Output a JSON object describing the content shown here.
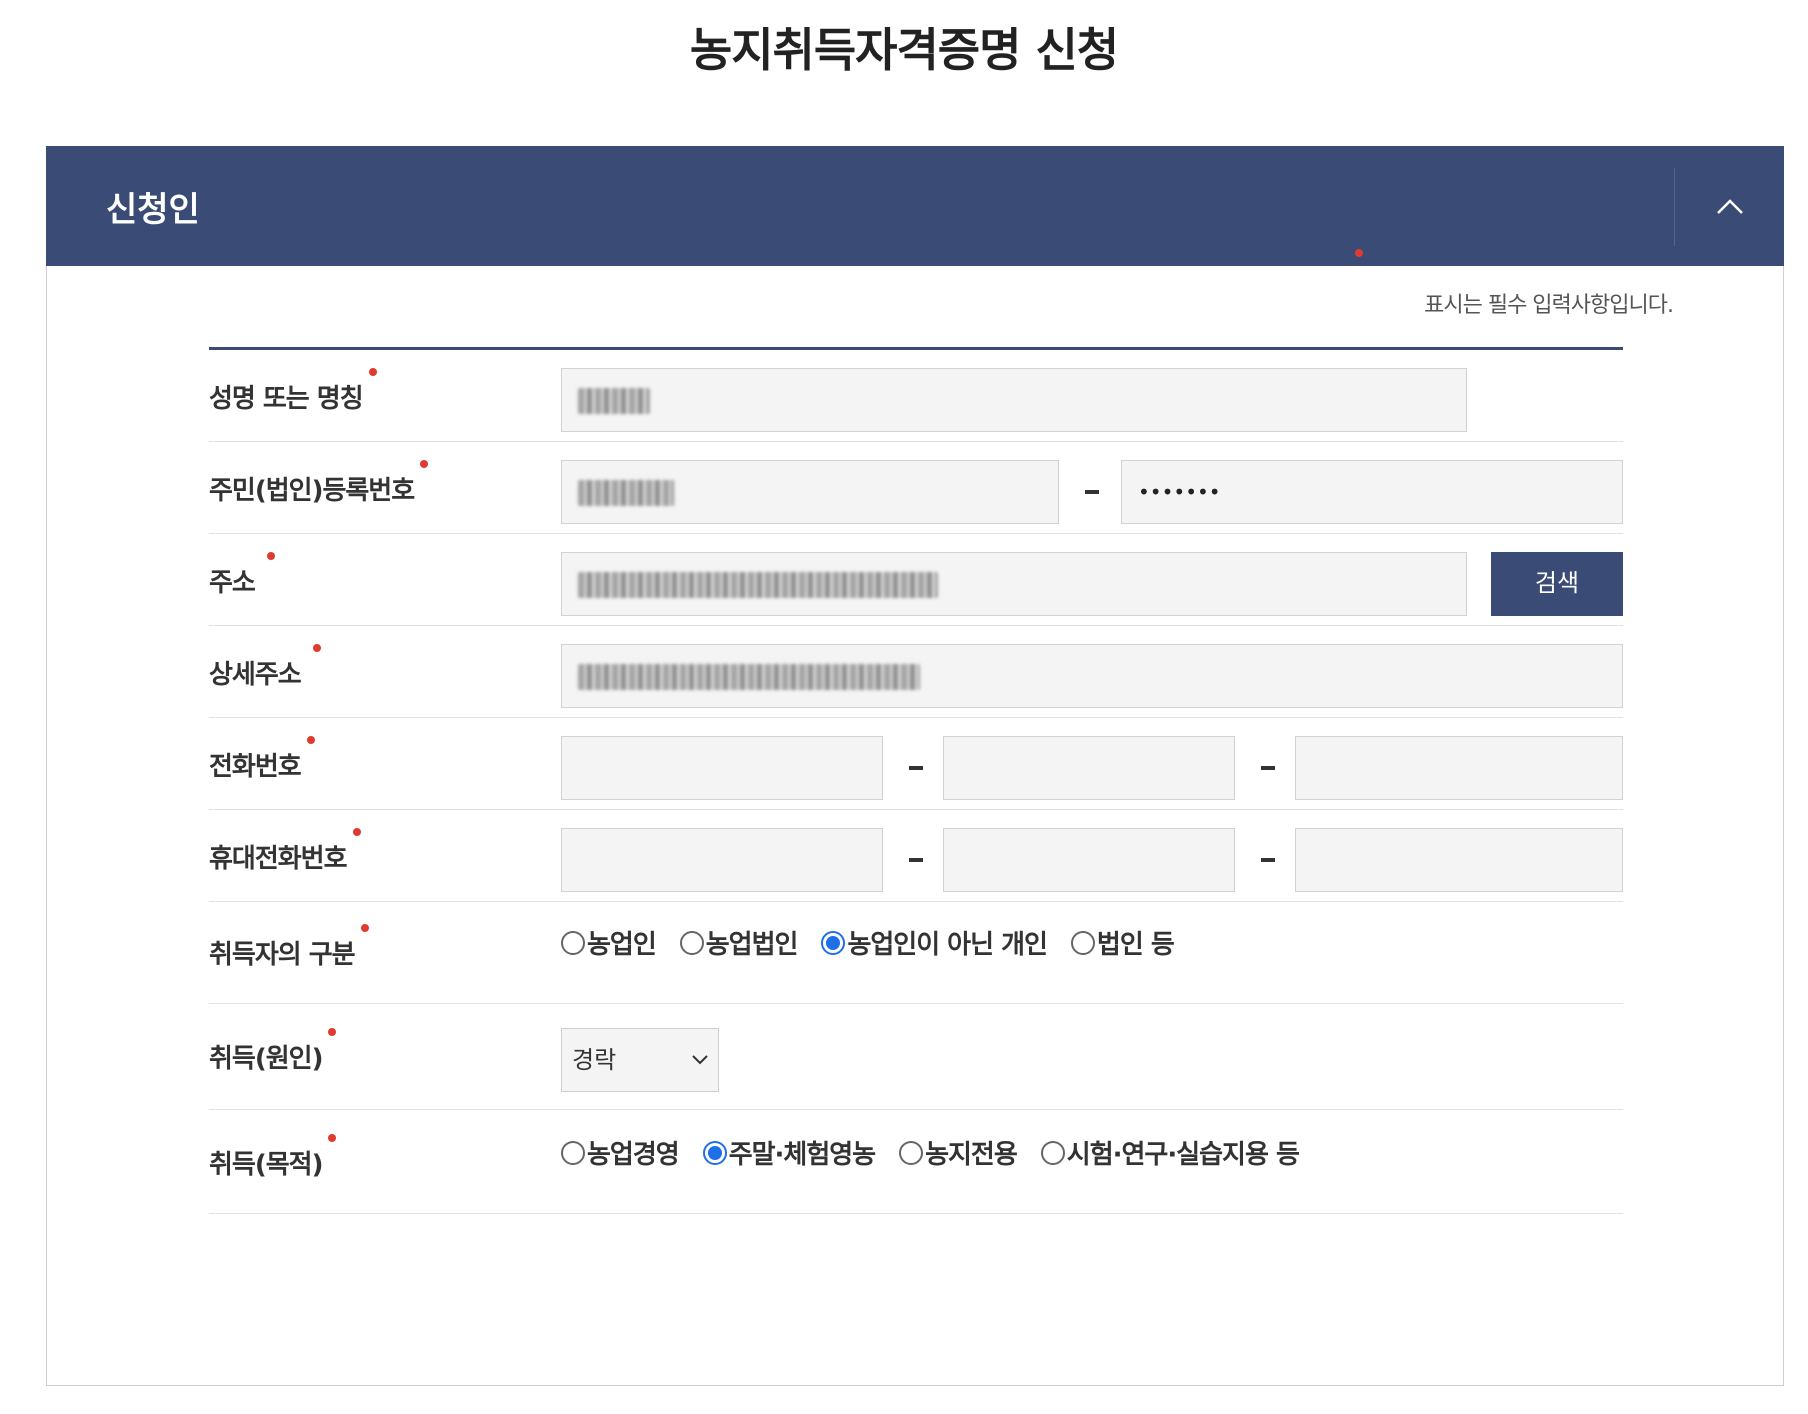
{
  "page": {
    "title": "농지취득자격증명 신청"
  },
  "panel": {
    "title": "신청인",
    "collapse_icon": "chevron-up-icon",
    "required_note": "표시는 필수 입력사항입니다."
  },
  "form": {
    "name": {
      "label": "성명 또는 명칭",
      "value": ""
    },
    "reg_no": {
      "label": "주민(법인)등록번호",
      "front": "",
      "back": "•••••••"
    },
    "address": {
      "label": "주소",
      "value": "",
      "search_label": "검색"
    },
    "address_detail": {
      "label": "상세주소",
      "value": ""
    },
    "phone": {
      "label": "전화번호"
    },
    "mobile": {
      "label": "휴대전화번호"
    },
    "acquirer_type": {
      "label": "취득자의 구분",
      "options": [
        "농업인",
        "농업법인",
        "농업인이 아닌 개인",
        "법인 등"
      ],
      "selected": "농업인이 아닌 개인"
    },
    "acquire_cause": {
      "label": "취득(원인)",
      "selected": "경락"
    },
    "acquire_purpose": {
      "label": "취득(목적)",
      "options": [
        "농업경영",
        "주말·체험영농",
        "농지전용",
        "시험·연구·실습지용 등"
      ],
      "selected": "주말·체험영농"
    }
  },
  "colors": {
    "header": "#3a4c75",
    "required_dot": "#e03b2f",
    "radio_checked": "#1f6fe6"
  }
}
